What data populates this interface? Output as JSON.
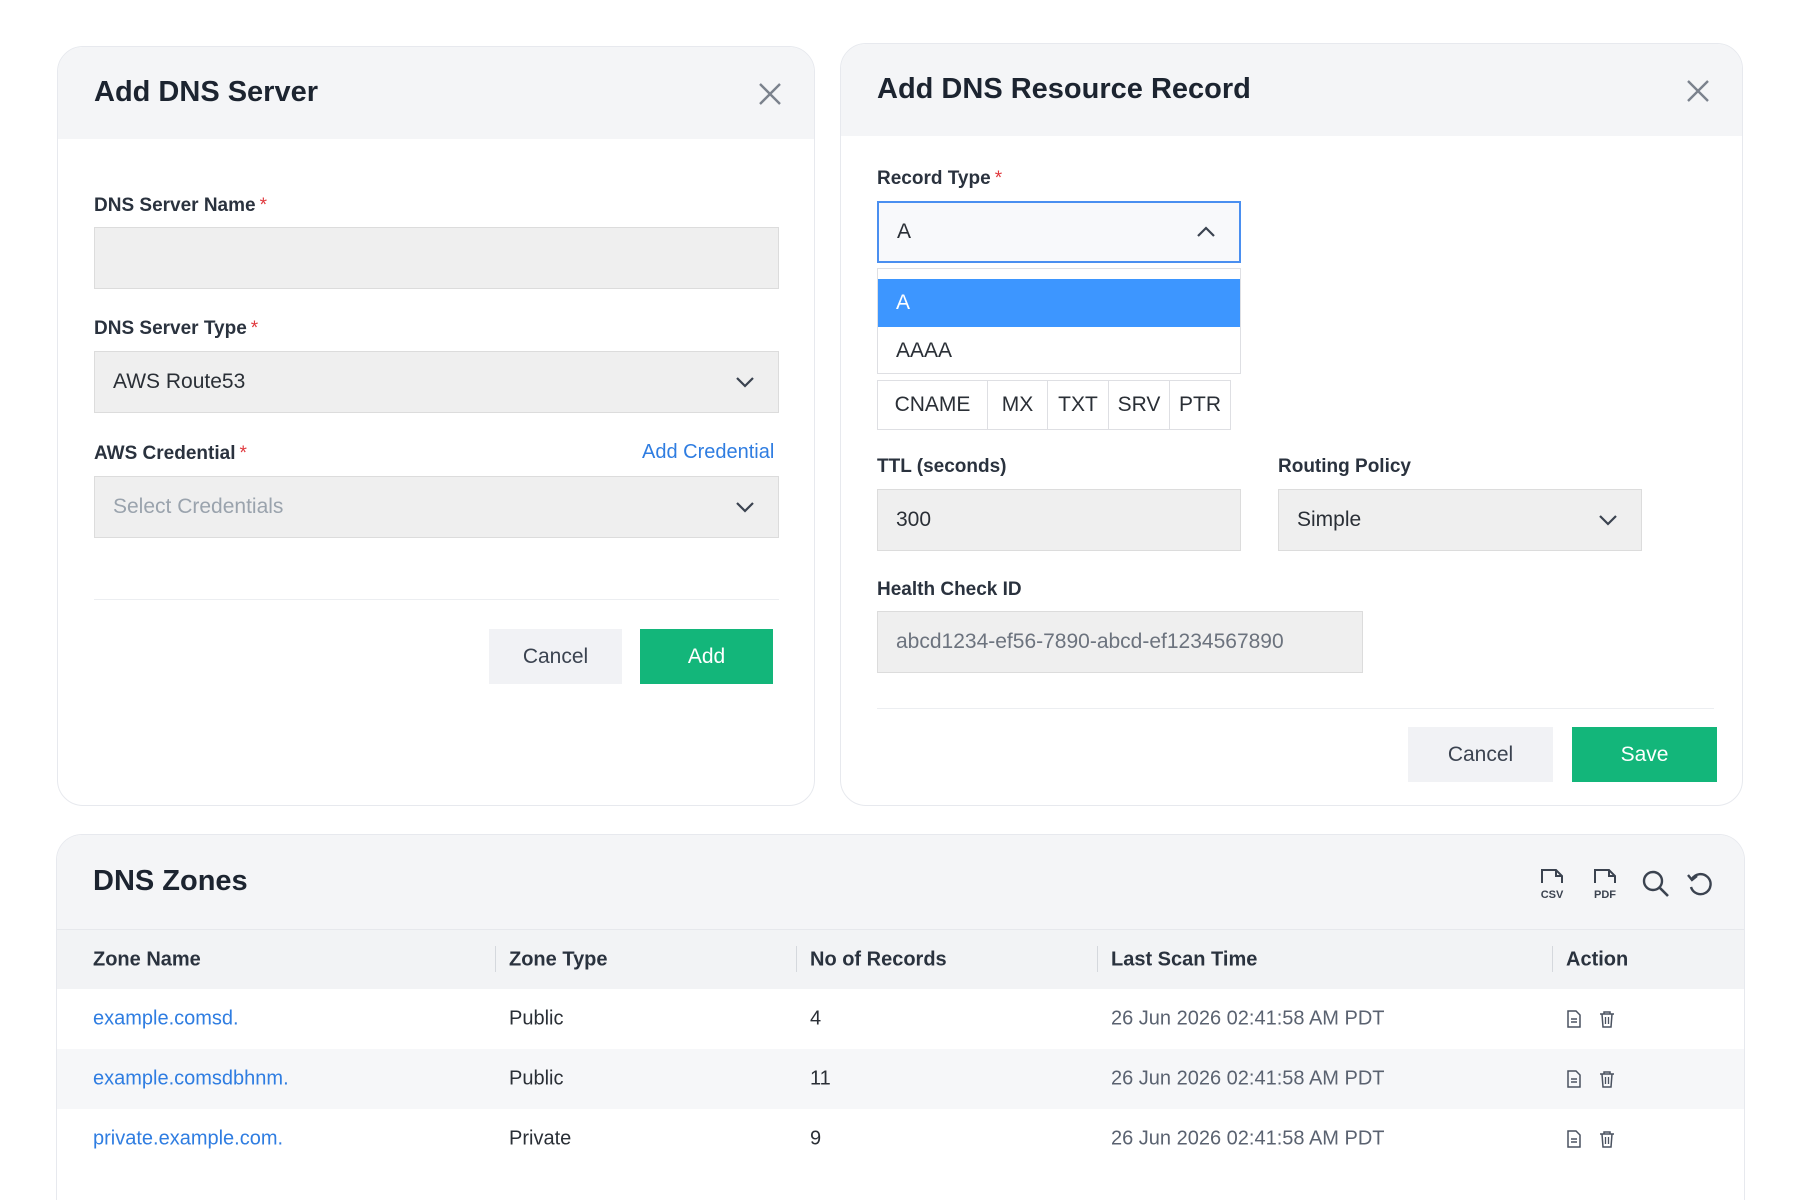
{
  "add_dns_server": {
    "title": "Add DNS Server",
    "name_label": "DNS Server Name",
    "name_value": "",
    "type_label": "DNS Server Type",
    "type_value": "AWS Route53",
    "credential_label": "AWS Credential",
    "add_credential_link": "Add Credential",
    "credential_placeholder": "Select Credentials",
    "required_mark": "*",
    "cancel_label": "Cancel",
    "add_label": "Add"
  },
  "add_dns_record": {
    "title": "Add DNS Resource Record",
    "record_type_label": "Record Type",
    "record_type_value": "A",
    "record_type_options": [
      "A",
      "AAAA"
    ],
    "record_type_chips": [
      "CNAME",
      "MX",
      "TXT",
      "SRV",
      "PTR"
    ],
    "ttl_label": "TTL (seconds)",
    "ttl_value": "300",
    "routing_label": "Routing Policy",
    "routing_value": "Simple",
    "health_label": "Health Check ID",
    "health_value": "abcd1234-ef56-7890-abcd-ef1234567890",
    "required_mark": "*",
    "cancel_label": "Cancel",
    "save_label": "Save"
  },
  "dns_zones": {
    "title": "DNS Zones",
    "tools": [
      "csv-export-icon",
      "pdf-export-icon",
      "search-icon",
      "refresh-icon"
    ],
    "tool_text": {
      "csv": "CSV",
      "pdf": "PDF"
    },
    "columns": [
      "Zone Name",
      "Zone Type",
      "No of Records",
      "Last Scan Time",
      "Action"
    ],
    "rows": [
      {
        "zone": "example.comsd.",
        "type": "Public",
        "records": "4",
        "scan": "26 Jun 2026 02:41:58 AM PDT"
      },
      {
        "zone": "example.comsdbhnm.",
        "type": "Public",
        "records": "11",
        "scan": "26 Jun 2026 02:41:58 AM PDT"
      },
      {
        "zone": "private.example.com.",
        "type": "Private",
        "records": "9",
        "scan": "26 Jun 2026 02:41:58 AM PDT"
      }
    ]
  },
  "colors": {
    "primary": "#13b67a",
    "link": "#2f7de1",
    "selected_option": "#3d96ff",
    "required": "#e0393e"
  }
}
